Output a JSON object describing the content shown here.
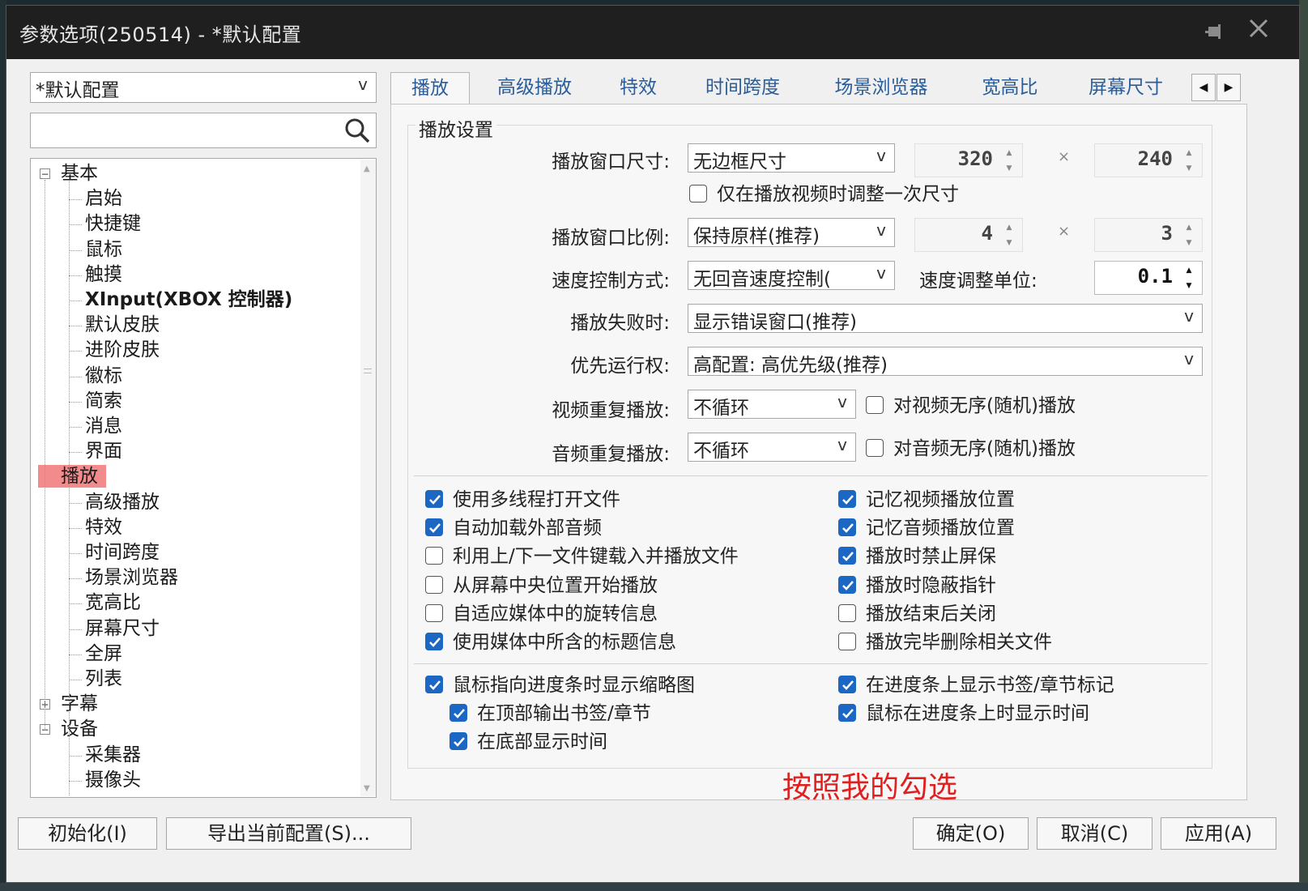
{
  "window": {
    "title": "参数选项(250514) - *默认配置"
  },
  "profile": {
    "selected": "*默认配置"
  },
  "search": {
    "value": ""
  },
  "tree": {
    "nodes": [
      {
        "label": "基本",
        "level": 0,
        "expander": "−"
      },
      {
        "label": "启始",
        "level": 1
      },
      {
        "label": "快捷键",
        "level": 1
      },
      {
        "label": "鼠标",
        "level": 1
      },
      {
        "label": "触摸",
        "level": 1
      },
      {
        "label": "XInput(XBOX 控制器)",
        "level": 1,
        "bold": true
      },
      {
        "label": "默认皮肤",
        "level": 1
      },
      {
        "label": "进阶皮肤",
        "level": 1
      },
      {
        "label": "徽标",
        "level": 1
      },
      {
        "label": "简索",
        "level": 1
      },
      {
        "label": "消息",
        "level": 1
      },
      {
        "label": "界面",
        "level": 1
      },
      {
        "label": "播放",
        "level": 0,
        "expander": "−",
        "selected": true
      },
      {
        "label": "高级播放",
        "level": 1
      },
      {
        "label": "特效",
        "level": 1
      },
      {
        "label": "时间跨度",
        "level": 1
      },
      {
        "label": "场景浏览器",
        "level": 1
      },
      {
        "label": "宽高比",
        "level": 1
      },
      {
        "label": "屏幕尺寸",
        "level": 1
      },
      {
        "label": "全屏",
        "level": 1
      },
      {
        "label": "列表",
        "level": 1
      },
      {
        "label": "字幕",
        "level": 0,
        "expander": "+"
      },
      {
        "label": "设备",
        "level": 0,
        "expander": "−"
      },
      {
        "label": "采集器",
        "level": 1
      },
      {
        "label": "摄像头",
        "level": 1
      }
    ]
  },
  "tabs": [
    "播放",
    "高级播放",
    "特效",
    "时间跨度",
    "场景浏览器",
    "宽高比",
    "屏幕尺寸"
  ],
  "tabnav": {
    "prev": "◀",
    "next": "▶"
  },
  "group": {
    "title": "播放设置"
  },
  "form": {
    "window_size_label": "播放窗口尺寸:",
    "window_size_value": "无边框尺寸",
    "width": "320",
    "height": "240",
    "times": "×",
    "resize_once": "仅在播放视频时调整一次尺寸",
    "ratio_label": "播放窗口比例:",
    "ratio_value": "保持原样(推荐)",
    "ratio_w": "4",
    "ratio_h": "3",
    "speed_mode_label": "速度控制方式:",
    "speed_mode_value": "无回音速度控制(",
    "speed_unit_label": "速度调整单位:",
    "speed_unit_value": "0.1",
    "fail_label": "播放失败时:",
    "fail_value": "显示错误窗口(推荐)",
    "priority_label": "优先运行权:",
    "priority_value": "高配置: 高优先级(推荐)",
    "video_repeat_label": "视频重复播放:",
    "video_repeat_value": "不循环",
    "video_shuffle": "对视频无序(随机)播放",
    "audio_repeat_label": "音频重复播放:",
    "audio_repeat_value": "不循环",
    "audio_shuffle": "对音频无序(随机)播放"
  },
  "options_left": [
    {
      "label": "使用多线程打开文件",
      "checked": true
    },
    {
      "label": "自动加载外部音频",
      "checked": true
    },
    {
      "label": "利用上/下一文件键载入并播放文件",
      "checked": false
    },
    {
      "label": "从屏幕中央位置开始播放",
      "checked": false
    },
    {
      "label": "自适应媒体中的旋转信息",
      "checked": false
    },
    {
      "label": "使用媒体中所含的标题信息",
      "checked": true
    }
  ],
  "options_right": [
    {
      "label": "记忆视频播放位置",
      "checked": true
    },
    {
      "label": "记忆音频播放位置",
      "checked": true
    },
    {
      "label": "播放时禁止屏保",
      "checked": true
    },
    {
      "label": "播放时隐蔽指针",
      "checked": true
    },
    {
      "label": "播放结束后关闭",
      "checked": false
    },
    {
      "label": "播放完毕删除相关文件",
      "checked": false
    }
  ],
  "thumbs": {
    "show_thumb": "鼠标指向进度条时显示缩略图",
    "top_bookmark": "在顶部输出书签/章节",
    "bottom_time": "在底部显示时间",
    "show_bookmark": "在进度条上显示书签/章节标记",
    "show_time": "鼠标在进度条上时显示时间"
  },
  "annotation": "按照我的勾选",
  "buttons": {
    "init": "初始化(I)",
    "export": "导出当前配置(S)...",
    "ok": "确定(O)",
    "cancel": "取消(C)",
    "apply": "应用(A)"
  },
  "colors": {
    "accent": "#1c67c3",
    "selected": "#f28b8b",
    "annotation": "#e02020",
    "tab_text": "#2a5d99"
  }
}
